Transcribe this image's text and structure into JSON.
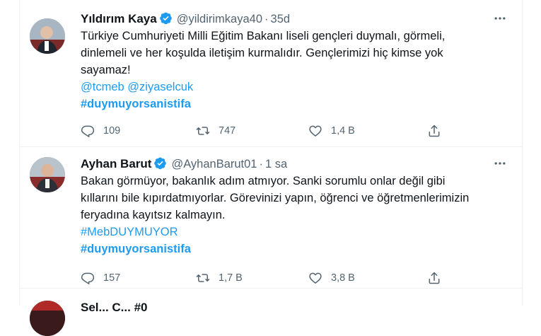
{
  "tweets": [
    {
      "name": "Yıldırım Kaya",
      "handle": "@yildirimkaya40",
      "dot": "·",
      "time": "35d",
      "text_lines": [
        "Türkiye Cumhuriyeti Milli Eğitim Bakanı liseli gençleri duymalı, görmeli,",
        "dinlemeli ve her koşulda iletişim kurmalıdır. Gençlerimizi hiç kimse yok",
        "sayamaz!"
      ],
      "mention_1": "@tcmeb",
      "mention_2": "@ziyaselcuk",
      "hashtag": "#duymuyorsanistifa",
      "reply_count": "109",
      "retweet_count": "747",
      "like_count": "1,4 B"
    },
    {
      "name": "Ayhan Barut",
      "handle": "@AyhanBarut01",
      "dot": "·",
      "time": "1 sa",
      "text_lines": [
        "Bakan görmüyor, bakanlık adım atmıyor. Sanki sorumlu onlar değil gibi",
        "kıllarını bile kıpırdatmıyorlar. Görevinizi yapın, öğrenci ve öğretmenlerimizin",
        "feryadına kayıtsız kalmayın."
      ],
      "hashtag_plain": "#MebDUYMUYOR",
      "hashtag": "#duymuyorsanistifa",
      "reply_count": "157",
      "retweet_count": "1,7 B",
      "like_count": "3,8 B"
    }
  ],
  "partial_tweet": {
    "name": "Sel...   C...   #0"
  },
  "colors": {
    "accent": "#1d9bf0",
    "text": "#0f1419",
    "muted": "#536471",
    "border": "#eff3f4"
  },
  "icons": {
    "reply": "reply-icon",
    "retweet": "retweet-icon",
    "like": "like-icon",
    "share": "share-icon",
    "more": "more-icon",
    "verified": "verified-badge-icon"
  }
}
